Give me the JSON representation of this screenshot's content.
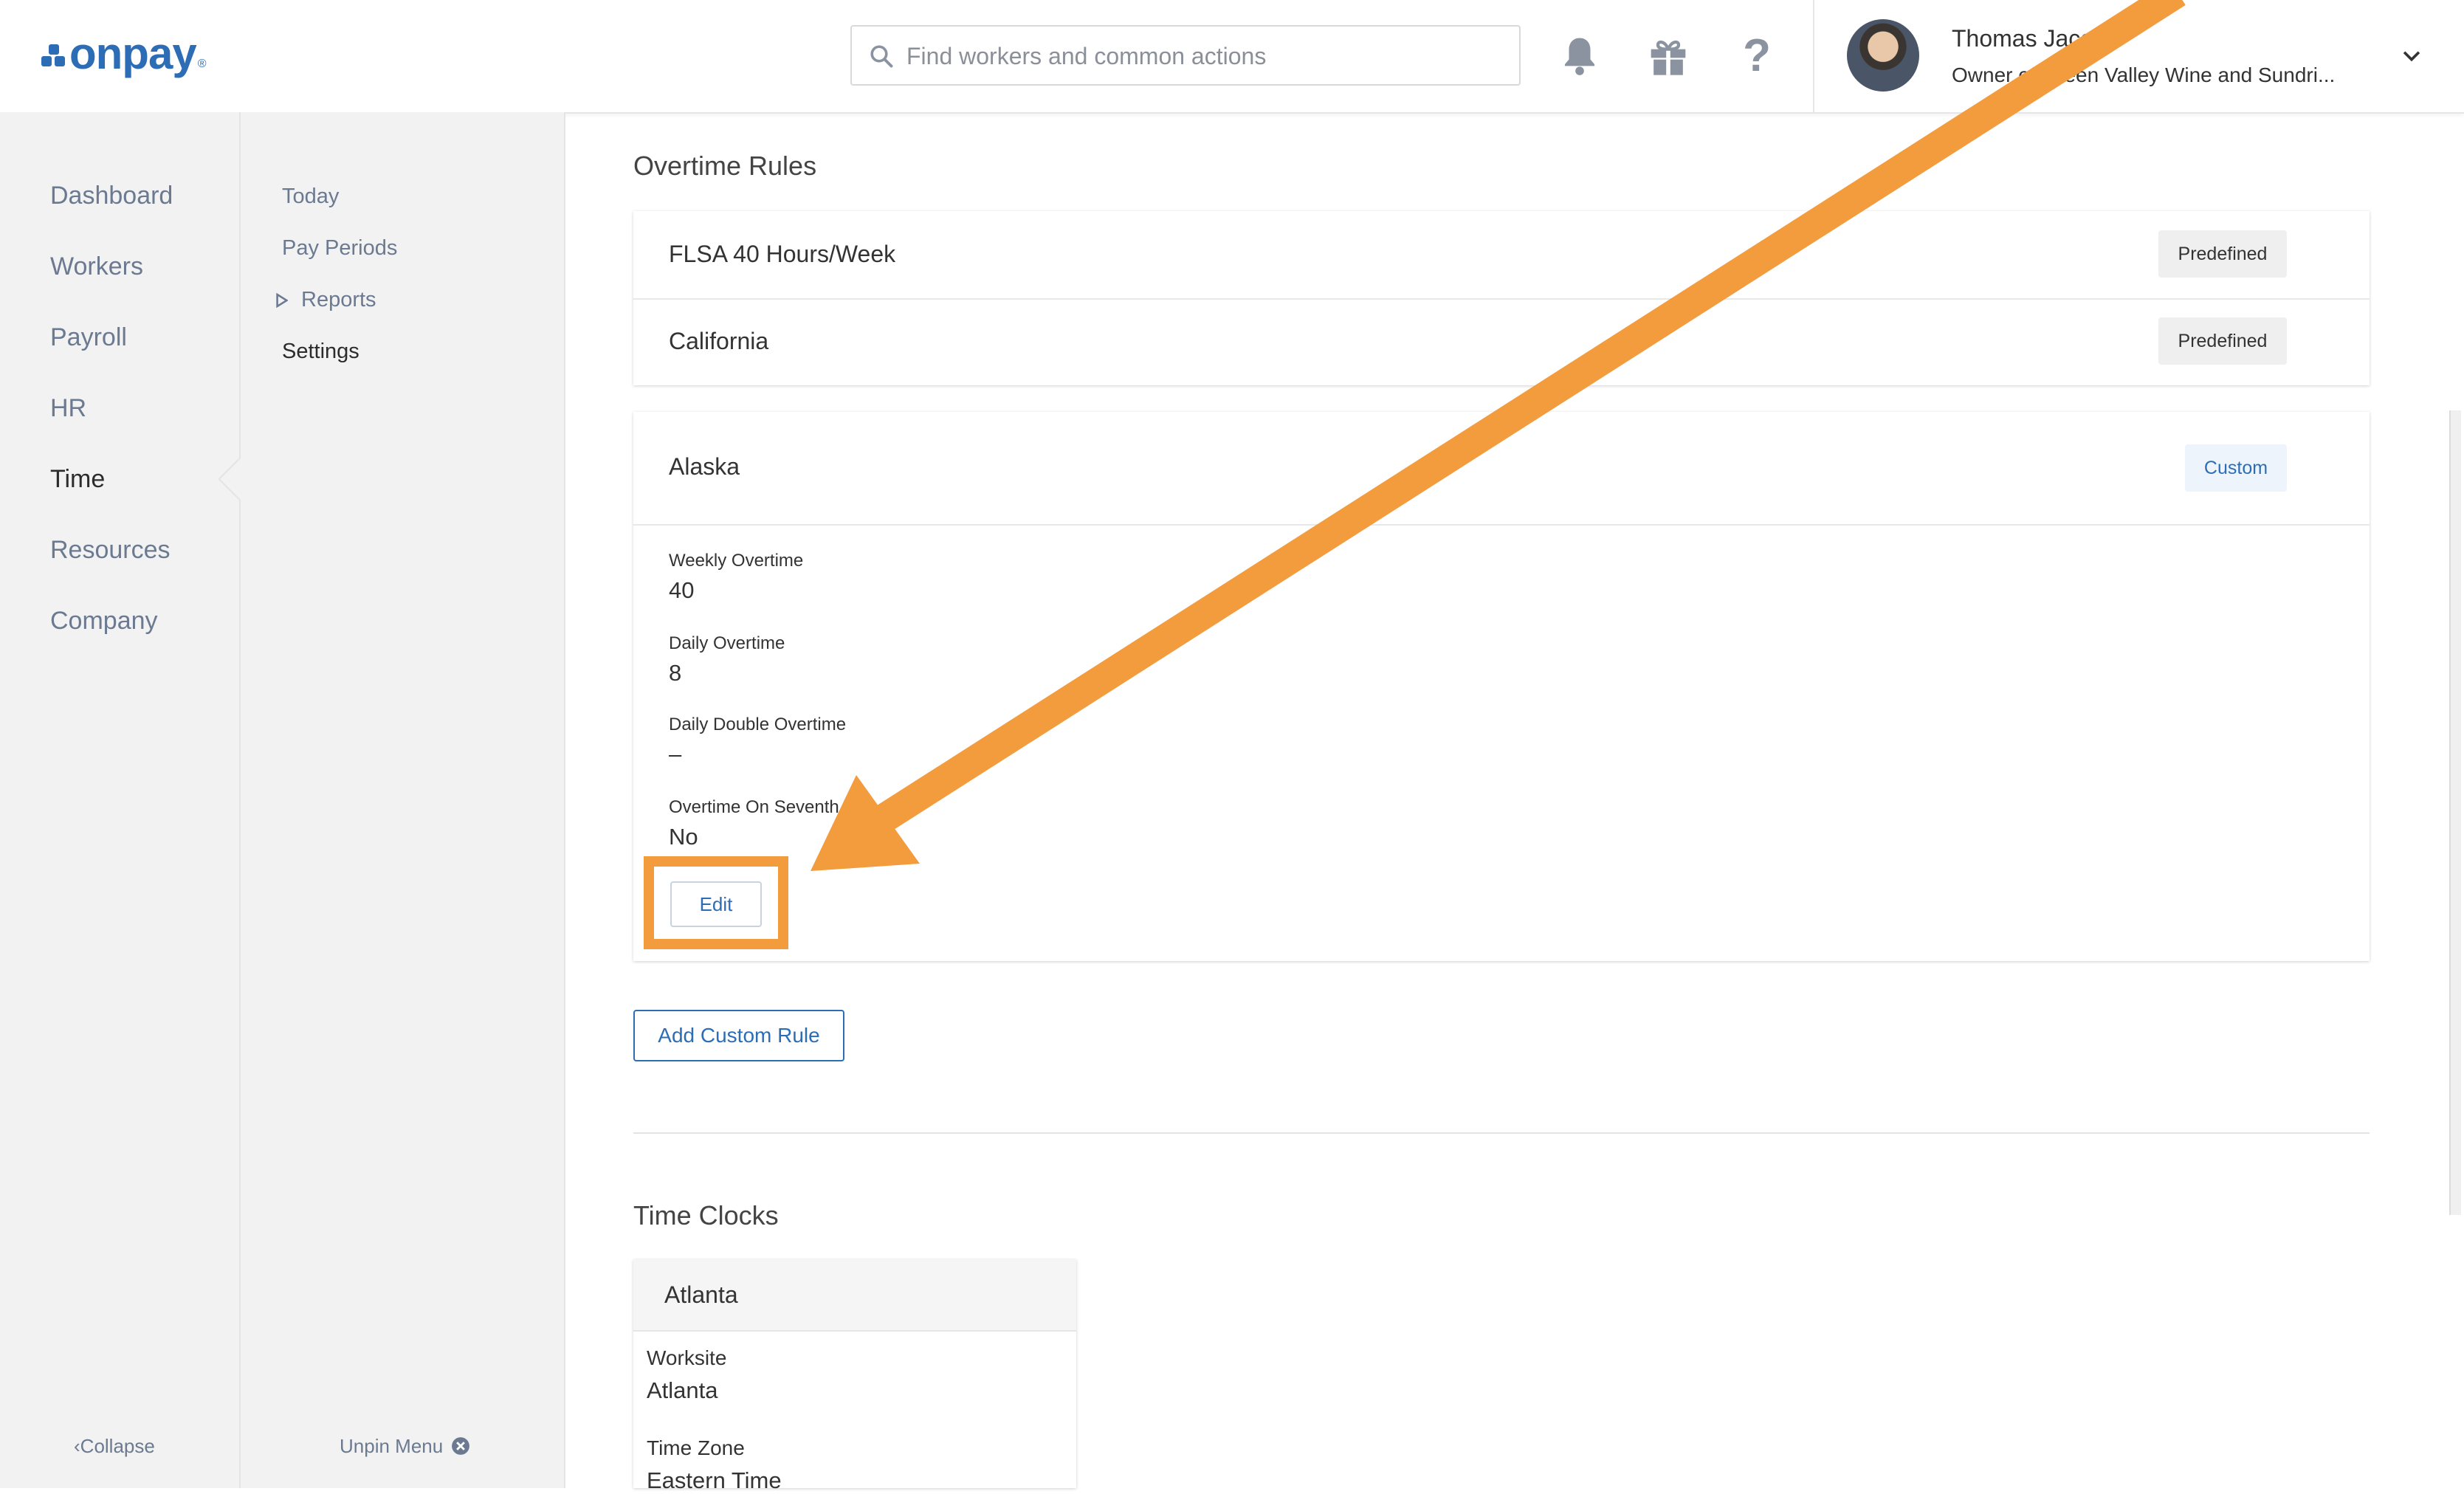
{
  "app": {
    "logo_text": "onpay",
    "logo_reg": "®",
    "brand_color": "#2d6db5"
  },
  "search": {
    "placeholder": "Find workers and common actions"
  },
  "header_icons": [
    "bell-icon",
    "gift-icon",
    "help-icon"
  ],
  "user": {
    "name": "Thomas Jacobs",
    "subtitle": "Owner of Green Valley Wine and Sundri..."
  },
  "nav": {
    "items": [
      "Dashboard",
      "Workers",
      "Payroll",
      "HR",
      "Time",
      "Resources",
      "Company"
    ],
    "active": "Time",
    "collapse_label": "Collapse"
  },
  "subnav": {
    "items": [
      "Today",
      "Pay Periods",
      "Reports",
      "Settings"
    ],
    "active": "Settings",
    "unpin_label": "Unpin Menu"
  },
  "overtime": {
    "title": "Overtime Rules",
    "rules": [
      {
        "name": "FLSA 40 Hours/Week",
        "badge": "Predefined"
      },
      {
        "name": "California",
        "badge": "Predefined"
      }
    ],
    "custom_rule": {
      "name": "Alaska",
      "badge": "Custom",
      "fields": [
        {
          "label": "Weekly Overtime",
          "value": "40"
        },
        {
          "label": "Daily Overtime",
          "value": "8"
        },
        {
          "label": "Daily Double Overtime",
          "value": "–"
        },
        {
          "label": "Overtime On Seventh Day",
          "value": "No"
        }
      ],
      "edit_label": "Edit"
    },
    "add_label": "Add Custom Rule"
  },
  "time_clocks": {
    "title": "Time Clocks",
    "clock": {
      "name": "Atlanta",
      "worksite_label": "Worksite",
      "worksite_value": "Atlanta",
      "timezone_label": "Time Zone",
      "timezone_value": "Eastern Time"
    }
  },
  "annotation": {
    "color": "#f39c3d",
    "target": "Edit"
  }
}
